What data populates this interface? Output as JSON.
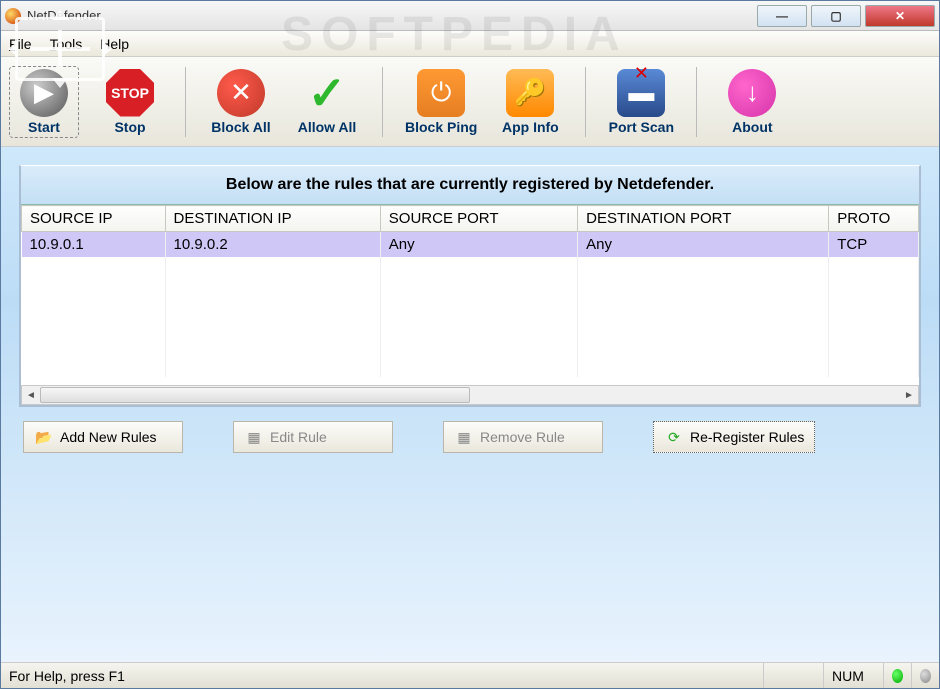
{
  "title": "NetDefender",
  "watermark": "SOFTPEDIA",
  "menu": {
    "file": "File",
    "tools": "Tools",
    "help": "Help"
  },
  "toolbar": {
    "start": "Start",
    "stop": "Stop",
    "block_all": "Block All",
    "allow_all": "Allow All",
    "block_ping": "Block Ping",
    "app_info": "App Info",
    "port_scan": "Port Scan",
    "about": "About",
    "stop_icon_text": "STOP"
  },
  "rules": {
    "heading": "Below are the rules that are currently registered by Netdefender.",
    "columns": {
      "source_ip": "SOURCE IP",
      "dest_ip": "DESTINATION IP",
      "source_port": "SOURCE PORT",
      "dest_port": "DESTINATION PORT",
      "proto": "PROTO"
    },
    "rows": [
      {
        "source_ip": "10.9.0.1",
        "dest_ip": "10.9.0.2",
        "source_port": "Any",
        "dest_port": "Any",
        "proto": "TCP"
      }
    ]
  },
  "actions": {
    "add": "Add New Rules",
    "edit": "Edit Rule",
    "remove": "Remove Rule",
    "reregister": "Re-Register Rules"
  },
  "status": {
    "help": "For Help, press F1",
    "num": "NUM"
  }
}
